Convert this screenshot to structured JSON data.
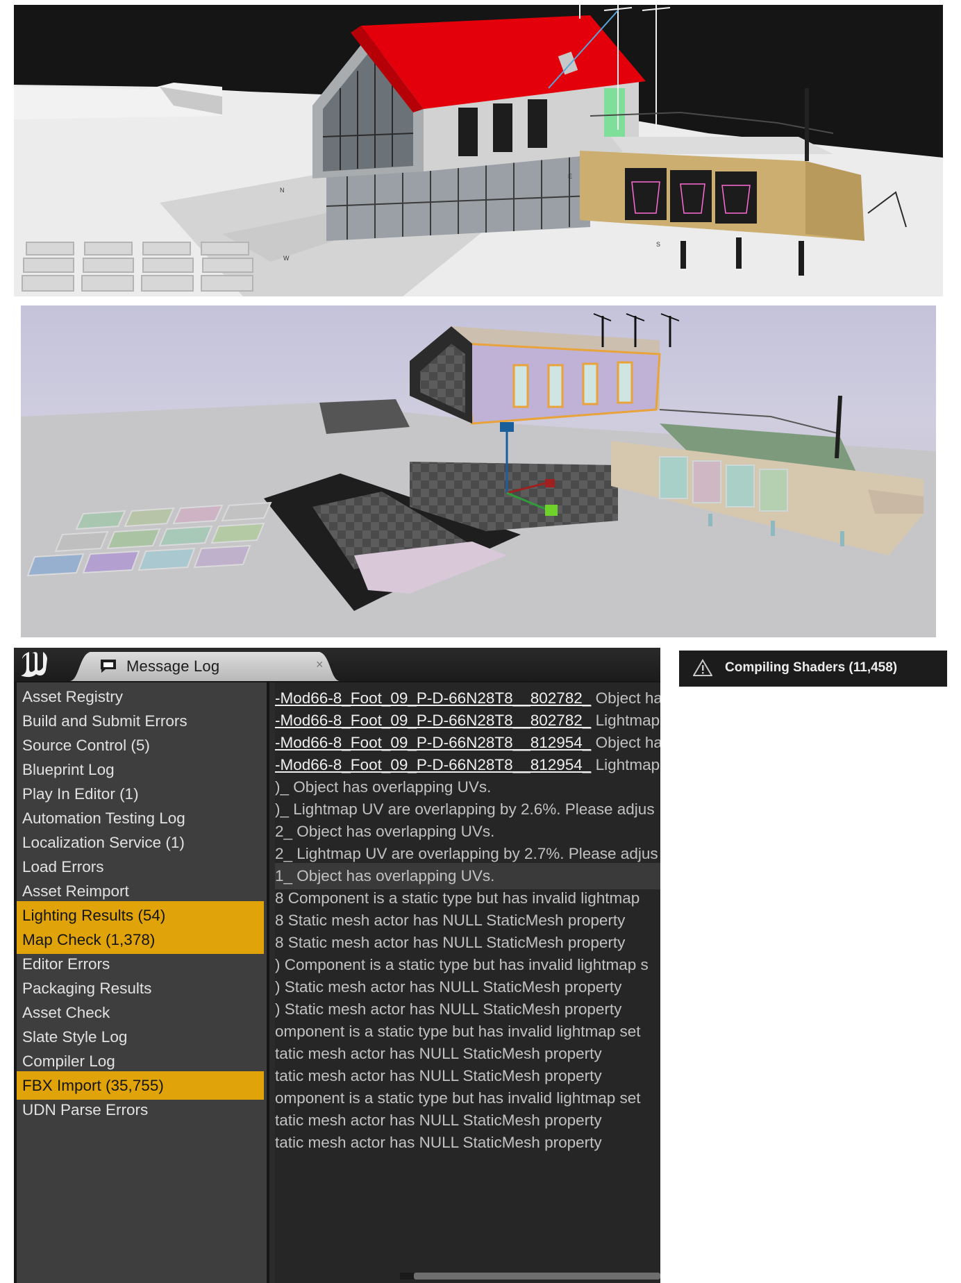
{
  "viewport_top": {
    "compass_labels": [
      "N",
      "E",
      "S",
      "W"
    ]
  },
  "viewport_bottom": {},
  "message_log": {
    "tab_title": "Message Log",
    "close_glyph": "×",
    "categories": [
      {
        "label": "Asset Registry",
        "selected": false
      },
      {
        "label": "Build and Submit Errors",
        "selected": false
      },
      {
        "label": "Source Control (5)",
        "selected": false
      },
      {
        "label": "Blueprint Log",
        "selected": false
      },
      {
        "label": "Play In Editor (1)",
        "selected": false
      },
      {
        "label": "Automation Testing Log",
        "selected": false
      },
      {
        "label": "Localization Service (1)",
        "selected": false
      },
      {
        "label": "Load Errors",
        "selected": false
      },
      {
        "label": "Asset Reimport",
        "selected": false
      },
      {
        "label": "Lighting Results (54)",
        "selected": true
      },
      {
        "label": "Map Check (1,378)",
        "selected": true
      },
      {
        "label": "Editor Errors",
        "selected": false
      },
      {
        "label": "Packaging Results",
        "selected": false
      },
      {
        "label": "Asset Check",
        "selected": false
      },
      {
        "label": "Slate Style Log",
        "selected": false
      },
      {
        "label": "Compiler Log",
        "selected": false
      },
      {
        "label": "FBX Import (35,755)",
        "selected": true
      },
      {
        "label": "UDN Parse Errors",
        "selected": false
      }
    ],
    "entries": [
      {
        "link": "-Mod66-8_Foot_09_P-D-66N28T8__802782_",
        "text": " Object has ov"
      },
      {
        "link": "-Mod66-8_Foot_09_P-D-66N28T8__802782_",
        "text": " Lightmap UV"
      },
      {
        "link": "-Mod66-8_Foot_09_P-D-66N28T8__812954_",
        "text": " Object has ov"
      },
      {
        "link": "-Mod66-8_Foot_09_P-D-66N28T8__812954_",
        "text": " Lightmap UV"
      },
      {
        "link": "",
        "text": ")_ Object has overlapping UVs."
      },
      {
        "link": "",
        "text": ")_ Lightmap UV are overlapping by 2.6%. Please adjus"
      },
      {
        "link": "",
        "text": "2_ Object has overlapping UVs."
      },
      {
        "link": "",
        "text": "2_ Lightmap UV are overlapping by 2.7%. Please adjus"
      },
      {
        "link": "",
        "text": "1_ Object has overlapping UVs."
      },
      {
        "link": "",
        "text": "8 Component is a static type but has invalid lightmap"
      },
      {
        "link": "",
        "text": "8 Static mesh actor has NULL StaticMesh property"
      },
      {
        "link": "",
        "text": "8 Static mesh actor has NULL StaticMesh property"
      },
      {
        "link": "",
        "text": ") Component is a static type but has invalid lightmap s"
      },
      {
        "link": "",
        "text": ") Static mesh actor has NULL StaticMesh property"
      },
      {
        "link": "",
        "text": ") Static mesh actor has NULL StaticMesh property"
      },
      {
        "link": "",
        "text": "omponent is a static type but has invalid lightmap set"
      },
      {
        "link": "",
        "text": "tatic mesh actor has NULL StaticMesh property"
      },
      {
        "link": "",
        "text": "tatic mesh actor has NULL StaticMesh property"
      },
      {
        "link": "",
        "text": "omponent is a static type but has invalid lightmap set"
      },
      {
        "link": "",
        "text": "tatic mesh actor has NULL StaticMesh property"
      },
      {
        "link": "",
        "text": "tatic mesh actor has NULL StaticMesh property"
      }
    ],
    "highlighted_entry_index": 8
  },
  "notification": {
    "text": "Compiling Shaders (11,458)",
    "icon": "warning-icon"
  },
  "colors": {
    "selected_category": "#e0a40a",
    "roof_red": "#e3000b",
    "editor_dark": "#161616"
  }
}
